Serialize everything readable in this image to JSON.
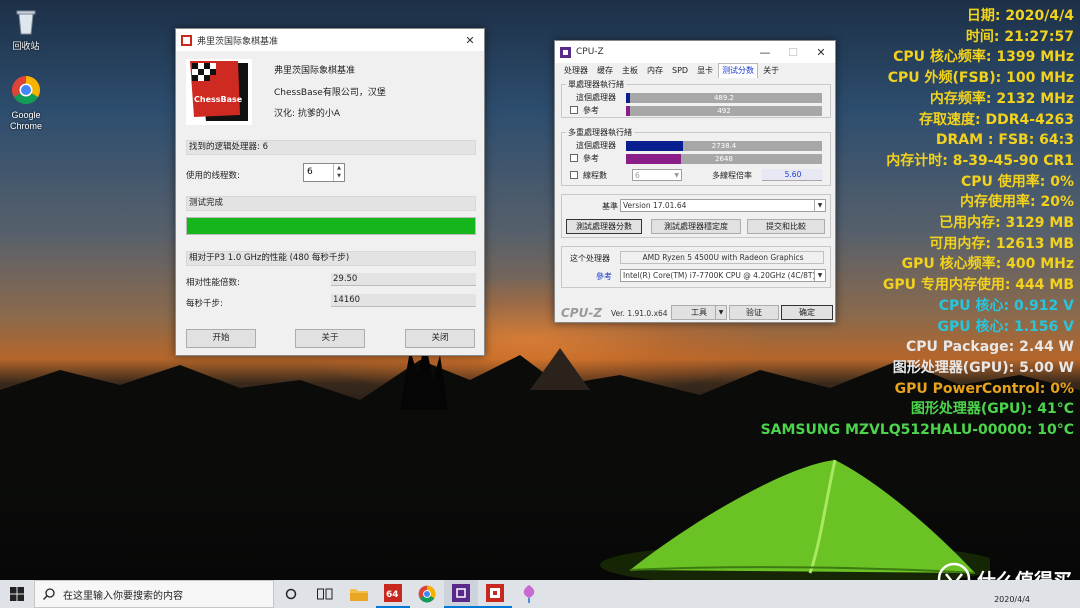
{
  "desktop": {
    "icons": [
      {
        "label": "回收站",
        "icon": "recycle-bin-icon"
      },
      {
        "label": "Google Chrome",
        "icon": "chrome-icon"
      }
    ]
  },
  "overlay": {
    "lines": [
      {
        "text": "日期: 2020/4/4",
        "color": "#f2d21c"
      },
      {
        "text": "时间: 21:27:57",
        "color": "#f2d21c"
      },
      {
        "text": "CPU 核心频率: 1399 MHz",
        "color": "#f2d21c"
      },
      {
        "text": "CPU 外频(FSB): 100 MHz",
        "color": "#f2d21c"
      },
      {
        "text": "内存频率: 2132 MHz",
        "color": "#f2d21c"
      },
      {
        "text": "存取速度: DDR4-4263",
        "color": "#f2d21c"
      },
      {
        "text": "DRAM : FSB: 64:3",
        "color": "#f2d21c"
      },
      {
        "text": "内存计时: 8-39-45-90 CR1",
        "color": "#f2d21c"
      },
      {
        "text": "CPU 使用率: 0%",
        "color": "#f2d21c"
      },
      {
        "text": "内存使用率: 20%",
        "color": "#f2d21c"
      },
      {
        "text": "已用内存: 3129 MB",
        "color": "#f2d21c"
      },
      {
        "text": "可用内存: 12613 MB",
        "color": "#f2d21c"
      },
      {
        "text": "GPU 核心频率: 400 MHz",
        "color": "#f2d21c"
      },
      {
        "text": "GPU 专用内存使用: 444 MB",
        "color": "#f2d21c"
      },
      {
        "text": "CPU 核心: 0.912 V",
        "color": "#27c6dd"
      },
      {
        "text": "GPU 核心: 1.156 V",
        "color": "#27c6dd"
      },
      {
        "text": "CPU Package: 2.44 W",
        "color": "#e8e8e8"
      },
      {
        "text": "图形处理器(GPU): 5.00 W",
        "color": "#e8e8e8"
      },
      {
        "text": "GPU PowerControl: 0%",
        "color": "#e8a21c"
      },
      {
        "text": "图形处理器(GPU): 41°C",
        "color": "#4cd44c"
      },
      {
        "text": "SAMSUNG MZVLQ512HALU-00000: 10°C",
        "color": "#4cd44c"
      }
    ]
  },
  "chess": {
    "title": "弗里茨国际象棋基准",
    "logo_text": "ChessBase",
    "info": [
      "弗里茨国际象棋基准",
      "ChessBase有限公司，汉堡",
      "汉化: 抗爹的小A"
    ],
    "processors_label": "找到的逻辑处理器: 6",
    "threads_label": "使用的线程数:",
    "threads_value": "6",
    "status": "测试完成",
    "progress": 1.0,
    "perf_header": "相对于P3 1.0 GHz的性能 (480 每秒千步)",
    "ratio_label": "相对性能倍数:",
    "ratio_value": "29.50",
    "kn_label": "每秒千步:",
    "kn_value": "14160",
    "buttons": {
      "start": "开始",
      "about": "关于",
      "close": "关闭"
    }
  },
  "cpuz": {
    "title": "CPU-Z",
    "tabs": [
      "处理器",
      "缓存",
      "主板",
      "内存",
      "SPD",
      "显卡",
      "测试分数",
      "关于"
    ],
    "active_tab": 6,
    "single": {
      "title": "單處理器執行緒",
      "this_label": "這個處理器",
      "this_value": "489.2",
      "ref_label": "參考",
      "ref_value": "492",
      "this_ratio": 0.022,
      "ref_ratio": 0.022
    },
    "multi": {
      "title": "多重處理器執行緒",
      "this_label": "這個處理器",
      "this_value": "2738.4",
      "ref_label": "參考",
      "ref_value": "2648",
      "this_ratio": 0.29,
      "ref_ratio": 0.28,
      "threads_label": "線程數",
      "threads_value": "6",
      "multiplier_label": "多線程倍率",
      "multiplier_value": "5.60"
    },
    "bench_label": "基準",
    "bench_value": "Version 17.01.64",
    "btn_bench": "測試處理器分數",
    "btn_stress": "測試處理器穩定度",
    "btn_submit": "提交和比較",
    "this_cpu_label": "这个处理器",
    "this_cpu_value": "AMD Ryzen 5 4500U with Radeon Graphics",
    "ref_cpu_label": "參考",
    "ref_cpu_value": "Intel(R) Core(TM) i7-7700K CPU @ 4.20GHz (4C/8T)",
    "brand": "CPU-Z",
    "version": "Ver. 1.91.0.x64",
    "tools": "工具",
    "verify": "验证",
    "ok": "确定",
    "colors": {
      "this": "#0a1f8f",
      "ref": "#8b1d8b",
      "track": "#a7a7a7"
    }
  },
  "taskbar": {
    "search_placeholder": "在这里输入你要搜索的内容",
    "date": "2020/4/4",
    "apps": [
      "cortana-icon",
      "task-view-icon",
      "file-explorer-icon",
      "aida64-icon",
      "chrome-icon",
      "cpuz-icon",
      "chessbase-icon",
      "paint-icon"
    ]
  },
  "watermark": {
    "text": "什么值得买",
    "logo": "值"
  }
}
